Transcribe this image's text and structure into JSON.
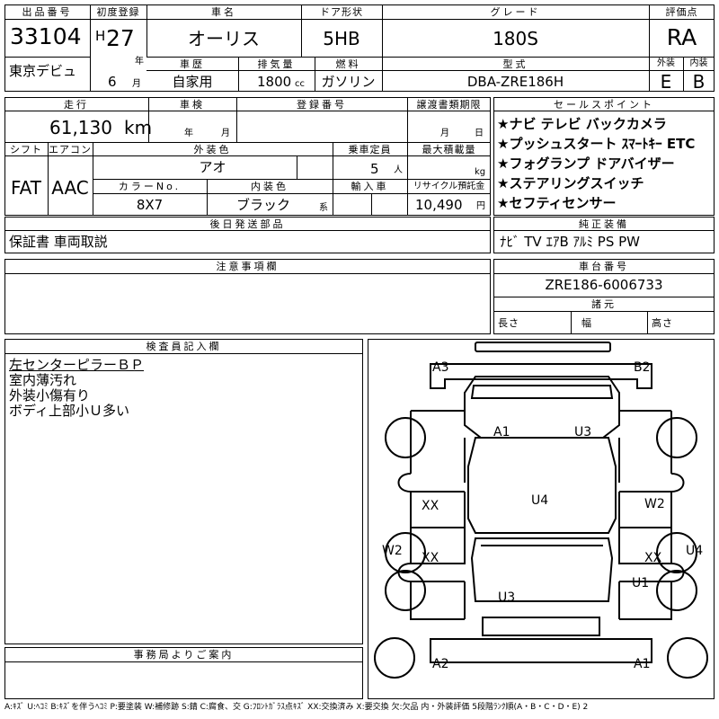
{
  "header": {
    "lot_label": "出品番号",
    "lot_number": "33104",
    "reg_label": "初度登録",
    "era": "H",
    "year": "27",
    "year_unit": "年",
    "month": "6",
    "month_unit": "月",
    "name_label": "車名",
    "name": "オーリス",
    "door_label": "ドア形状",
    "door": "5HB",
    "grade_label": "グレード",
    "grade": "180S",
    "score_label": "評価点",
    "score": "RA",
    "venue": "東京デビュ",
    "history_label": "車歴",
    "history": "自家用",
    "displacement_label": "排気量",
    "displacement": "1800",
    "displacement_unit": "cc",
    "fuel_label": "燃料",
    "fuel": "ガソリン",
    "model_label": "型式",
    "model": "DBA-ZRE186H",
    "ext_label": "外装",
    "ext_grade": "E",
    "int_label": "内装",
    "int_grade": "B"
  },
  "specs": {
    "mileage_label": "走行",
    "mileage": "61,130",
    "mileage_unit": "km",
    "inspection_label": "車検",
    "inspection_year_unit": "年",
    "inspection_month_unit": "月",
    "plate_label": "登録番号",
    "transfer_label": "譲渡書類期限",
    "transfer_month_unit": "月",
    "transfer_day_unit": "日",
    "shift_label": "シフト",
    "shift": "FAT",
    "ac_label": "エアコン",
    "ac": "AAC",
    "ext_color_label": "外装色",
    "ext_color": "アオ",
    "capacity_label": "乗車定員",
    "capacity": "5",
    "capacity_unit": "人",
    "max_load_label": "最大積載量",
    "max_load_unit": "kg",
    "color_no_label": "カラーNo.",
    "color_no": "8X7",
    "int_color_label": "内装色",
    "int_color": "ブラック",
    "int_color_suffix": "系",
    "import_label": "輸入車",
    "recycle_label": "リサイクル預託金",
    "recycle": "10,490",
    "recycle_unit": "円"
  },
  "sales_points": {
    "label": "セールスポイント",
    "items": [
      "★ナビ テレビ バックカメラ",
      "★プッシュスタート ｽﾏｰﾄｷｰ ETC",
      "★フォグランプ ドアバイザー",
      "★ステアリングスイッチ",
      "★セフティセンサー"
    ]
  },
  "later_parts": {
    "label": "後日発送部品",
    "value": "保証書 車両取説"
  },
  "equipment": {
    "label": "純正装備",
    "value": "ﾅﾋﾞ TV ｴｱB ｱﾙﾐ PS PW"
  },
  "notes": {
    "label": "注意事項欄",
    "value": ""
  },
  "chassis": {
    "label": "車台番号",
    "value": "ZRE186-6006733"
  },
  "dims": {
    "label": "諸元",
    "length_label": "長さ",
    "width_label": "幅",
    "height_label": "高さ"
  },
  "inspector": {
    "label": "検査員記入欄",
    "lines": [
      "左センターピラーＢＰ",
      "室内薄汚れ",
      "外装小傷有り",
      "ボディ上部小Ｕ多い"
    ]
  },
  "office": {
    "label": "事務局よりご案内"
  },
  "diagram_marks": [
    "A3",
    "B2",
    "A1",
    "U3",
    "XX",
    "U4",
    "W2",
    "W2",
    "XX",
    "XX",
    "U4",
    "U1",
    "U3",
    "A2",
    "A1"
  ],
  "footer": "A:ｷｽﾞ U:ﾍｺﾐ B:ｷｽﾞを伴うﾍｺﾐ P:要塗装 W:補修跡 S:錆 C:腐食、交 G:ﾌﾛﾝﾄｶﾞﾗｽ点ｷｽﾞ XX:交換済み X:要交換 欠:欠品 内・外装評価 5段階ﾗﾝｸ順(A・B・C・D・E) 2"
}
